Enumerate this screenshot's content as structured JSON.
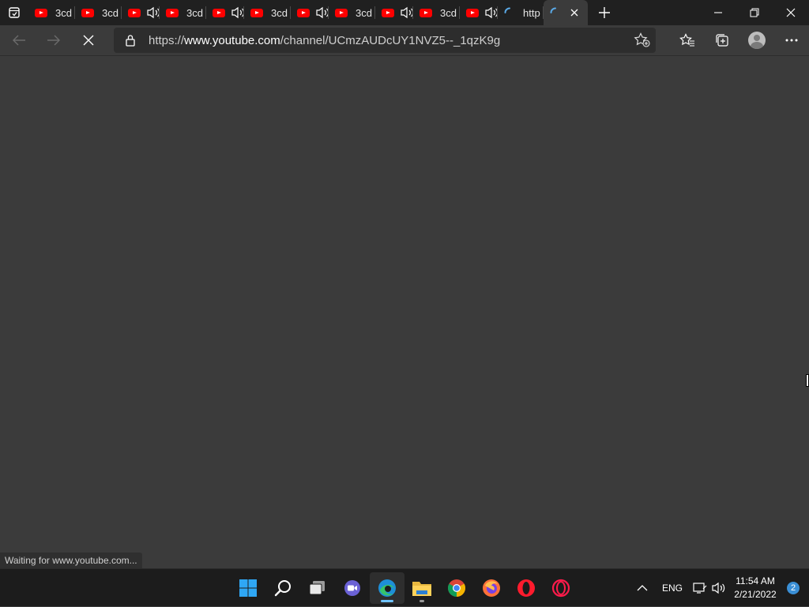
{
  "browser": {
    "tabs": [
      {
        "title": "3cd",
        "muted_icon": false
      },
      {
        "title": "3cd",
        "muted_icon": false
      },
      {
        "title": "",
        "muted_icon": true
      },
      {
        "title": "3cd",
        "muted_icon": false
      },
      {
        "title": "",
        "muted_icon": true
      },
      {
        "title": "3cd",
        "muted_icon": false
      },
      {
        "title": "",
        "muted_icon": true
      },
      {
        "title": "3cd",
        "muted_icon": false
      },
      {
        "title": "",
        "muted_icon": true
      },
      {
        "title": "3cd",
        "muted_icon": false
      },
      {
        "title": "",
        "muted_icon": true
      },
      {
        "title": "http",
        "loading": true
      },
      {
        "title": "",
        "active": true,
        "loading": true
      }
    ],
    "address": {
      "scheme": "https://",
      "host": "www.youtube.com",
      "path": "/channel/UCmzAUDcUY1NVZ5--_1qzK9g"
    },
    "status_text": "Waiting for www.youtube.com...",
    "colors": {
      "tabstrip": "#202020",
      "toolbar": "#3b3b3b",
      "address_bg": "#2d2d2d",
      "youtube_red": "#ff0000",
      "edge_accent": "#3a8fd6"
    }
  },
  "taskbar": {
    "apps": [
      {
        "name": "start-button",
        "icon": "windows-logo"
      },
      {
        "name": "search-button",
        "icon": "search-icon"
      },
      {
        "name": "task-view-button",
        "icon": "task-view-icon"
      },
      {
        "name": "teams-chat-button",
        "icon": "teams-icon"
      },
      {
        "name": "edge-button",
        "icon": "edge-icon",
        "active": true
      },
      {
        "name": "file-explorer-button",
        "icon": "folder-icon"
      },
      {
        "name": "chrome-button",
        "icon": "chrome-icon"
      },
      {
        "name": "firefox-button",
        "icon": "firefox-icon"
      },
      {
        "name": "opera-button",
        "icon": "opera-icon"
      },
      {
        "name": "opera-gx-button",
        "icon": "opera-gx-icon"
      }
    ],
    "tray": {
      "language": "ENG",
      "time": "11:54 AM",
      "date": "2/21/2022",
      "notifications": "2"
    }
  }
}
